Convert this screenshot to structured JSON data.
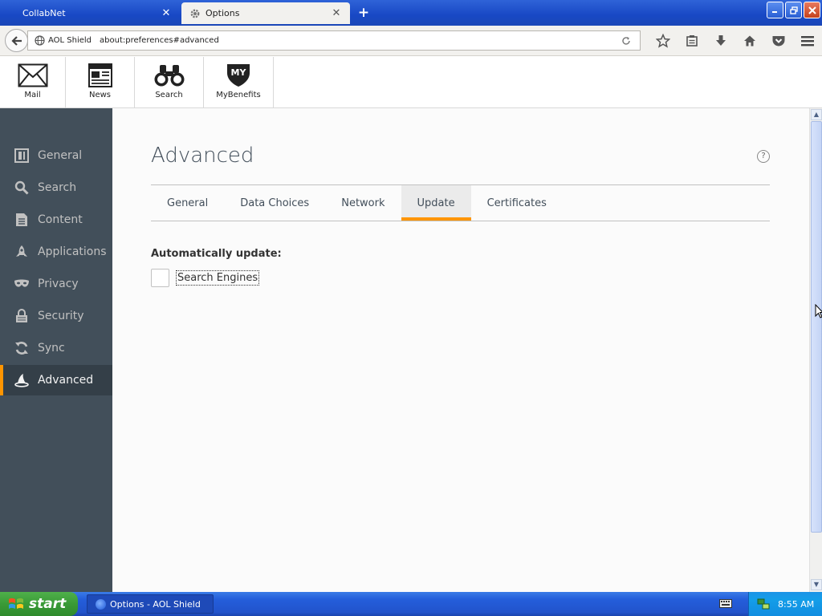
{
  "browser": {
    "tabs": [
      {
        "label": "CollabNet"
      },
      {
        "label": "Options"
      }
    ],
    "new_tab_label": "+",
    "close_glyph": "✕",
    "site_identity": "AOL Shield",
    "url": "about:preferences#advanced"
  },
  "app_toolbar": {
    "items": [
      {
        "label": "Mail",
        "icon": "mail-icon"
      },
      {
        "label": "News",
        "icon": "news-icon"
      },
      {
        "label": "Search",
        "icon": "binoculars-icon"
      },
      {
        "label": "MyBenefits",
        "icon": "mybenefits-shield-icon"
      }
    ],
    "mybenefits_badge": "MY"
  },
  "sidebar": {
    "items": [
      {
        "label": "General",
        "icon": "general-icon"
      },
      {
        "label": "Search",
        "icon": "search-icon"
      },
      {
        "label": "Content",
        "icon": "content-icon"
      },
      {
        "label": "Applications",
        "icon": "rocket-icon"
      },
      {
        "label": "Privacy",
        "icon": "mask-icon"
      },
      {
        "label": "Security",
        "icon": "padlock-icon"
      },
      {
        "label": "Sync",
        "icon": "sync-icon"
      },
      {
        "label": "Advanced",
        "icon": "wizard-hat-icon",
        "active": true
      }
    ],
    "active_color": "#ff9500"
  },
  "main": {
    "title": "Advanced",
    "help_glyph": "?",
    "tabs": [
      {
        "label": "General"
      },
      {
        "label": "Data Choices"
      },
      {
        "label": "Network"
      },
      {
        "label": "Update",
        "active": true
      },
      {
        "label": "Certificates"
      }
    ],
    "section_label": "Automatically update:",
    "checkbox": {
      "label": "Search Engines",
      "checked": false
    }
  },
  "taskbar": {
    "start_label": "start",
    "window_item": "Options - AOL Shield",
    "clock": "8:55 AM"
  }
}
